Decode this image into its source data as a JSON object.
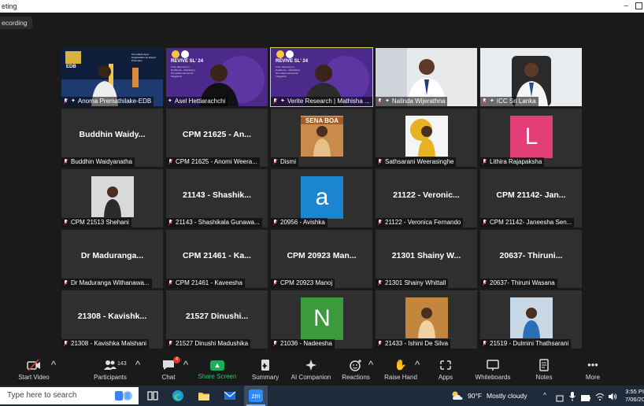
{
  "window": {
    "title": "eting",
    "minimize": "–"
  },
  "recording": {
    "label": "ecording"
  },
  "participants": [
    {
      "name": "Anoma Premathilake-EDB",
      "type": "video",
      "muted": true,
      "pinned": true,
      "slide_title": "EDB",
      "slide_sub": "Sri Lanka's Apex Organization for Export Promotion"
    },
    {
      "name": "Asel Hettiarachchi",
      "type": "video",
      "muted": false,
      "pinned": true,
      "banner": "REVIVE SL' 24",
      "banner_sub": "From Recovery to Resilience - Rethinking Sri Lanka's Economic Integration"
    },
    {
      "name": "Verite Research | Mathisha ...",
      "type": "video",
      "muted": true,
      "pinned": true,
      "active": true,
      "banner": "REVIVE SL' 24",
      "banner_sub": "From Recovery to Resilience - Rethinking Sri Lanka's Economic Integration"
    },
    {
      "name": "Nalinda Wijerathna",
      "type": "video",
      "muted": true,
      "pinned": true
    },
    {
      "name": "ICC Sri Lanka",
      "type": "video",
      "muted": true,
      "pinned": true
    },
    {
      "name": "Buddhin Waidyanatha",
      "display": "Buddhin  Waidy...",
      "type": "text",
      "muted": true
    },
    {
      "name": "CPM 21625 - Anomi Weera...",
      "display": "CPM 21625 - An...",
      "type": "text",
      "muted": true
    },
    {
      "name": "Dismi",
      "type": "photo",
      "muted": true,
      "photo_text": "SENA BOA"
    },
    {
      "name": "Sathsarani Weerasinghe",
      "type": "photo",
      "muted": true
    },
    {
      "name": "Lithira Rajapaksha",
      "type": "letter",
      "letter": "L",
      "color": "#e23f78",
      "muted": true
    },
    {
      "name": "CPM 21513 Shehani",
      "type": "photo",
      "muted": true
    },
    {
      "name": "21143 - Shashikala Gunawa...",
      "display": "21143 - Shashik...",
      "type": "text",
      "muted": true
    },
    {
      "name": "20956 - Avishka",
      "type": "letter",
      "letter": "a",
      "color": "#1a86d0",
      "muted": true
    },
    {
      "name": "21122 - Veronica Fernando",
      "display": "21122 - Veronic...",
      "type": "text",
      "muted": true
    },
    {
      "name": "CPM 21142- Janeesha Sen...",
      "display": "CPM 21142- Jan...",
      "type": "text",
      "muted": true
    },
    {
      "name": "Dr Maduranga Withanawa...",
      "display": "Dr  Maduranga...",
      "type": "text",
      "muted": true
    },
    {
      "name": "CPM 21461 - Kaveesha",
      "display": "CPM 21461 - Ka...",
      "type": "text",
      "muted": true
    },
    {
      "name": "CPM 20923 Manoj",
      "display": "CPM 20923 Man...",
      "type": "text",
      "muted": true
    },
    {
      "name": "21301 Shainy Whittall",
      "display": "21301 Shainy W...",
      "type": "text",
      "muted": true
    },
    {
      "name": "20637- Thiruni Wasana",
      "display": "20637- Thiruni...",
      "type": "text",
      "muted": true
    },
    {
      "name": "21308 - Kavishka Malshani",
      "display": "21308 - Kavishk...",
      "type": "text",
      "muted": true
    },
    {
      "name": "21527 Dinushi Madushika",
      "display": "21527 Dinushi...",
      "type": "text",
      "muted": true
    },
    {
      "name": "21036 - Nadeesha",
      "type": "letter",
      "letter": "N",
      "color": "#3a9a3c",
      "muted": true
    },
    {
      "name": "21433 - Ishini De Silva",
      "type": "photo",
      "muted": true
    },
    {
      "name": "21519 - Dulmini Thathsarani",
      "type": "photo",
      "muted": true
    }
  ],
  "toolbar": {
    "start_video": "Start Video",
    "participants": "Participants",
    "participants_count": "143",
    "chat": "Chat",
    "chat_badge": "4",
    "share_screen": "Share Screen",
    "summary": "Summary",
    "ai_companion": "AI Companion",
    "reactions": "Reactions",
    "raise_hand": "Raise Hand",
    "apps": "Apps",
    "whiteboards": "Whiteboards",
    "notes": "Notes",
    "more": "More"
  },
  "taskbar": {
    "search_placeholder": "Type here to search",
    "weather_temp": "90°F",
    "weather_desc": "Mostly cloudy",
    "time": "3:55 PI",
    "date": "7/06/20"
  },
  "colors": {
    "accent_green": "#1aae5a",
    "active_border": "#c8e04a",
    "mute_red": "#e0342e"
  }
}
